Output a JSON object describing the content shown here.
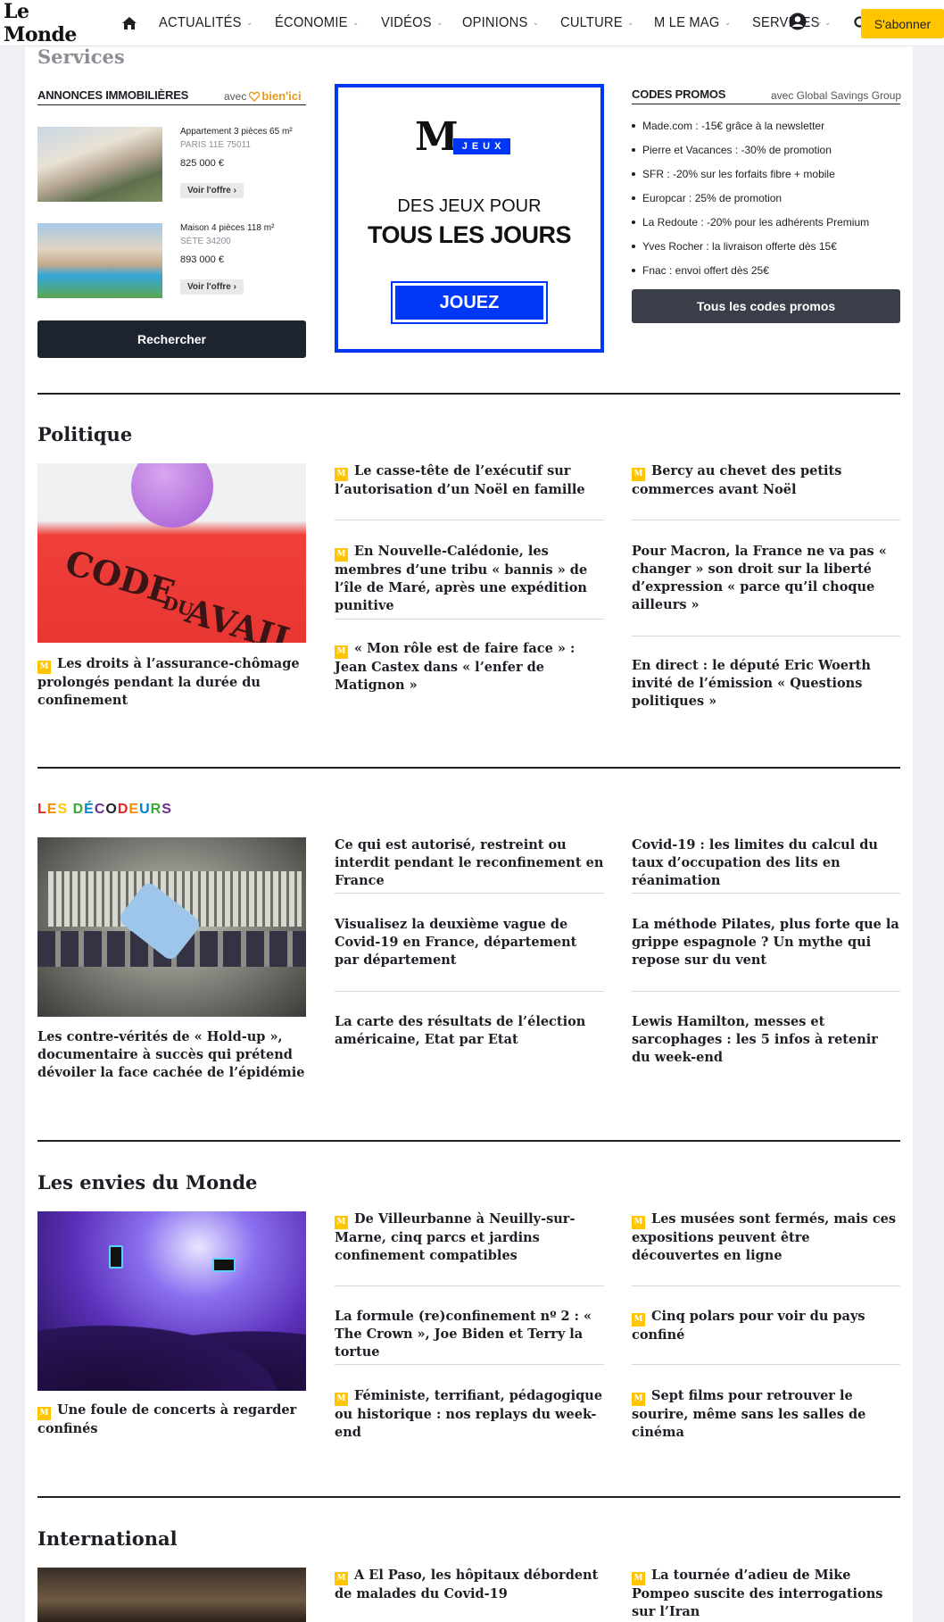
{
  "nav": {
    "logo": "Le Monde",
    "items": [
      {
        "label": "ACTUALITÉS",
        "has_dropdown": true
      },
      {
        "label": "ÉCONOMIE",
        "has_dropdown": true
      },
      {
        "label": "VIDÉOS",
        "has_dropdown": true
      },
      {
        "label": "OPINIONS",
        "has_dropdown": true
      },
      {
        "label": "CULTURE",
        "has_dropdown": true
      },
      {
        "label": "M LE MAG",
        "has_dropdown": true
      },
      {
        "label": "SERVICES",
        "has_dropdown": true
      }
    ],
    "chevron": "⌄",
    "subscribe": "S'abonner",
    "icons": [
      "home-icon",
      "search-icon",
      "account-icon",
      "chevron-down-icon"
    ]
  },
  "services": {
    "title": "Services",
    "immo": {
      "heading": "ANNONCES IMMOBILIÈRES",
      "partner_prefix": "avec",
      "partner_name": "bien'ici",
      "listings": [
        {
          "title": "Appartement 3 pièces 65 m²",
          "location": "PARIS 11E 75011",
          "price": "825 000 €",
          "cta": "Voir l'offre ›"
        },
        {
          "title": "Maison 4 pièces 118 m²",
          "location": "SÈTE 34200",
          "price": "893 000 €",
          "cta": "Voir l'offre ›"
        }
      ],
      "search_button": "Rechercher"
    },
    "ad": {
      "logo": "M",
      "badge": "JEUX",
      "line1": "DES JEUX POUR",
      "line2": "TOUS LES JOURS",
      "button": "JOUEZ"
    },
    "promos": {
      "heading": "CODES PROMOS",
      "partner": "avec Global Savings Group",
      "items": [
        "Made.com : -15€ grâce à la newsletter",
        "Pierre et Vacances : -30% de promotion",
        "SFR : -20% sur les forfaits fibre + mobile",
        "Europcar : 25% de promotion",
        "La Redoute : -20% pour les adhérents Premium",
        "Yves Rocher : la livraison offerte dès 15€",
        "Fnac : envoi offert dès 25€"
      ],
      "button": "Tous les codes promos"
    }
  },
  "badge_letter": "M",
  "sections": [
    {
      "title": "Politique",
      "image_caption": {
        "text": "Les droits à l’assurance-chômage prolongés pendant la durée du confinement",
        "premium": true
      },
      "image_text": {
        "line1": "CODE",
        "line2": "DU",
        "line3": "AVAIL"
      },
      "col2": [
        {
          "text": "Le casse-tête de l’exécutif sur l’autorisation d’un Noël en famille",
          "premium": true
        },
        {
          "text": "En Nouvelle-Calédonie, les membres d’une tribu « bannis » de l’île de Maré, après une expédition punitive",
          "premium": true
        },
        {
          "text": "« Mon rôle est de faire face » : Jean Castex dans « l’enfer de Matignon »",
          "premium": true
        }
      ],
      "col3": [
        {
          "text": "Bercy au chevet des petits commerces avant Noël",
          "premium": true
        },
        {
          "text": "Pour Macron, la France ne va pas « changer » son droit sur la liberté d’expression « parce qu’il choque ailleurs »",
          "premium": false
        },
        {
          "text": "En direct : le député Eric Woerth invité de l’émission « Questions politiques »",
          "premium": false
        }
      ]
    },
    {
      "title": "LES DÉCODEURS",
      "decodeurs_colors": [
        "#e1251b",
        "#f28c00",
        "#ffc600",
        "#3aaa35",
        "#0083c8",
        "#6a2c91",
        "#1d1f24",
        "#e1251b",
        "#f28c00",
        "#0083c8",
        "#3aaa35",
        "#6a2c91",
        "#1d1f24"
      ],
      "image_caption": {
        "text": "Les contre-vérités de « Hold-up », documentaire à succès qui prétend dévoiler la face cachée de l’épidémie",
        "premium": false
      },
      "col2": [
        {
          "text": "Ce qui est autorisé, restreint ou interdit pendant le reconfinement en France",
          "premium": false
        },
        {
          "text": "Visualisez la deuxième vague de Covid-19 en France, département par département",
          "premium": false
        },
        {
          "text": "La carte des résultats de l’élection américaine, Etat par Etat",
          "premium": false
        }
      ],
      "col3": [
        {
          "text": "Covid-19 : les limites du calcul du taux d’occupation des lits en réanimation",
          "premium": false
        },
        {
          "text": "La méthode Pilates, plus forte que la grippe espagnole ? Un mythe qui repose sur du vent",
          "premium": false
        },
        {
          "text": "Lewis Hamilton, messes et sarcophages : les 5 infos à retenir du week-end",
          "premium": false
        }
      ]
    },
    {
      "title": "Les envies du Monde",
      "image_caption": {
        "text": "Une foule de concerts à regarder confinés",
        "premium": true
      },
      "col2": [
        {
          "text": "De Villeurbanne à Neuilly-sur-Marne, cinq parcs et jardins confinement compatibles",
          "premium": true
        },
        {
          "text": "La formule (re)confinement nº 2 : « The Crown », Joe Biden et Terry la tortue",
          "premium": false
        },
        {
          "text": "Féministe, terrifiant, pédagogique ou historique : nos replays du week-end",
          "premium": true
        }
      ],
      "col3": [
        {
          "text": "Les musées sont fermés, mais ces expositions peuvent être découvertes en ligne",
          "premium": true
        },
        {
          "text": "Cinq polars pour voir du pays confiné",
          "premium": true
        },
        {
          "text": "Sept films pour retrouver le sourire, même sans les salles de cinéma",
          "premium": true
        }
      ]
    },
    {
      "title": "International",
      "col2": [
        {
          "text": "A El Paso, les hôpitaux débordent de malades du Covid-19",
          "premium": true
        }
      ],
      "col3": [
        {
          "text": "La tournée d’adieu de Mike Pompeo suscite des interrogations sur l’Iran",
          "premium": true
        }
      ]
    }
  ]
}
